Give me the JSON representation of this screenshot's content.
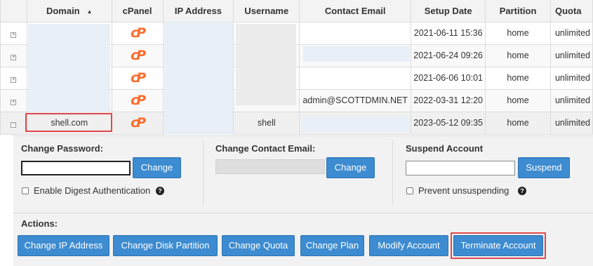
{
  "table": {
    "columns": [
      "",
      "Domain",
      "cPanel",
      "IP Address",
      "Username",
      "Contact Email",
      "Setup Date",
      "Partition",
      "Quota"
    ],
    "sort_arrow": "▲",
    "rows": [
      {
        "expander": "+",
        "domain": "",
        "username": "",
        "email": "",
        "setup_date": "2021-06-11 15:36",
        "partition": "home",
        "quota": "unlimited"
      },
      {
        "expander": "+",
        "domain": "",
        "username": "",
        "email": "",
        "setup_date": "2021-06-24 09:26",
        "partition": "home",
        "quota": "unlimited"
      },
      {
        "expander": "+",
        "domain": "",
        "username": "",
        "email": "",
        "setup_date": "2021-06-06 10:01",
        "partition": "home",
        "quota": "unlimited"
      },
      {
        "expander": "+",
        "domain": "",
        "username": "",
        "email": "admin@SCOTTDMIN.NET",
        "setup_date": "2022-03-31 12:20",
        "partition": "home",
        "quota": "unlimited"
      },
      {
        "expander": "−",
        "domain": "shell.com",
        "username": "shell",
        "email": "",
        "setup_date": "2023-05-12 09:35",
        "partition": "home",
        "quota": "unlimited"
      }
    ]
  },
  "panel": {
    "change_password": {
      "label": "Change Password:",
      "button": "Change",
      "checkbox_label": "Enable Digest Authentication"
    },
    "change_email": {
      "label": "Change Contact Email:",
      "button": "Change"
    },
    "suspend": {
      "label": "Suspend Account",
      "button": "Suspend",
      "checkbox_label": "Prevent unsuspending"
    },
    "actions": {
      "label": "Actions:",
      "buttons": [
        "Change IP Address",
        "Change Disk Partition",
        "Change Quota",
        "Change Plan",
        "Modify Account",
        "Terminate Account"
      ]
    }
  },
  "icons": {
    "cpanel": "cpanel-logo-icon",
    "help": "help-icon",
    "sort": "sort-ascending-icon"
  },
  "colors": {
    "accent": "#3d8bd0",
    "link": "#1a7db3",
    "cpanel_orange": "#ff6c2c",
    "highlight": "#e0474c"
  }
}
